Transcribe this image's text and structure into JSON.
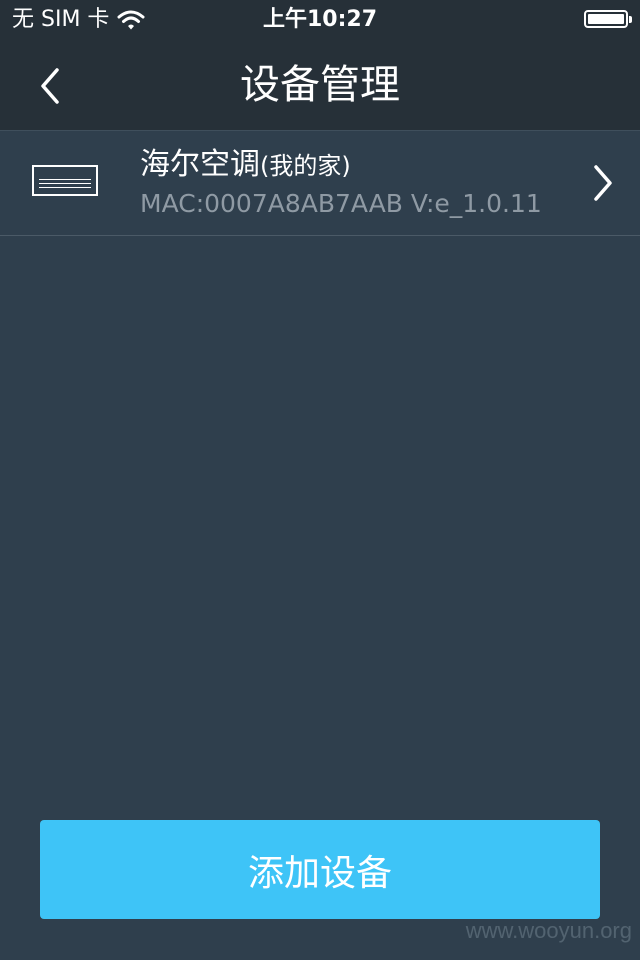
{
  "status_bar": {
    "carrier": "无 SIM 卡",
    "time": "上午10:27",
    "wifi_icon": "wifi-icon",
    "battery_icon": "battery-icon",
    "battery_level": 1.0
  },
  "nav": {
    "back_icon": "chevron-left-icon",
    "title": "设备管理"
  },
  "device": {
    "icon": "air-conditioner-icon",
    "name": "海尔空调",
    "location": "(我的家)",
    "mac": "MAC:0007A8AB7AAB V:e_1.0.11",
    "chevron_icon": "chevron-right-icon"
  },
  "add_button": {
    "label": "添加设备"
  },
  "watermark": "www.wooyun.org",
  "colors": {
    "background": "#2f3f4d",
    "header": "#263038",
    "accent": "#3ec4f7",
    "secondary_text": "#8f9aa4"
  }
}
